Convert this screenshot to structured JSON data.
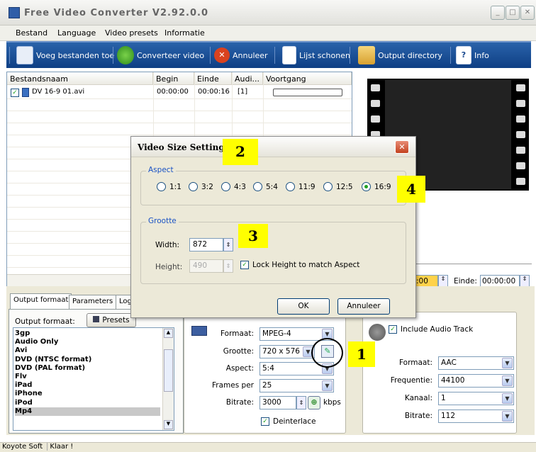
{
  "window": {
    "title": "Free Video Converter V2.92.0.0",
    "min": "_",
    "max": "□",
    "close": "✕"
  },
  "menu": [
    "Bestand",
    "Language",
    "Video presets",
    "Informatie"
  ],
  "toolbar": {
    "add": "Voeg bestanden toe",
    "convert": "Converteer video",
    "cancel": "Annuleer",
    "clear": "Lijst schonen",
    "output": "Output directory",
    "info": "Info"
  },
  "filelist": {
    "headers": [
      "Bestandsnaam",
      "Begin",
      "Einde",
      "Audi...",
      "Voortgang"
    ],
    "rows": [
      {
        "name": "DV 16-9 01.avi",
        "begin": "00:00:00",
        "end": "00:00:16",
        "audio": "[1]",
        "checked": "✓"
      }
    ]
  },
  "timing": {
    "begin_value": ":00",
    "end_label": "Einde:",
    "end_value": "00:00:00"
  },
  "tabs": [
    "Output formaat",
    "Parameters",
    "Log"
  ],
  "output_format": {
    "label": "Output formaat:",
    "presets": "Presets",
    "items": [
      "3gp",
      "Audio Only",
      "Avi",
      "DVD (NTSC format)",
      "DVD (PAL format)",
      "Flv",
      "iPad",
      "iPhone",
      "iPod",
      "Mp4"
    ],
    "selected_index": 9
  },
  "video": {
    "format_label": "Formaat:",
    "format": "MPEG-4",
    "size_label": "Grootte:",
    "size": "720 x 576",
    "aspect_label": "Aspect:",
    "aspect": "5:4",
    "fps_label": "Frames per",
    "fps": "25",
    "bitrate_label": "Bitrate:",
    "bitrate": "3000",
    "bitrate_unit": "kbps",
    "deinterlace": "Deinterlace"
  },
  "audio": {
    "include": "Include Audio Track",
    "format_label": "Formaat:",
    "format": "AAC",
    "freq_label": "Frequentie:",
    "freq": "44100",
    "channel_label": "Kanaal:",
    "channel": "1",
    "bitrate_label": "Bitrate:",
    "bitrate": "112"
  },
  "status": {
    "company": "Koyote Soft",
    "state": "Klaar !"
  },
  "dialog": {
    "title": "Video Size Settings",
    "aspect_legend": "Aspect",
    "aspect_options": [
      "1:1",
      "3:2",
      "4:3",
      "5:4",
      "11:9",
      "12:5",
      "16:9"
    ],
    "aspect_selected": "16:9",
    "size_legend": "Grootte",
    "width_label": "Width:",
    "width": "872",
    "height_label": "Height:",
    "height": "490",
    "lock_label": "Lock Height to match Aspect",
    "ok": "OK",
    "cancel": "Annuleer"
  },
  "callouts": [
    "1",
    "2",
    "3",
    "4"
  ]
}
